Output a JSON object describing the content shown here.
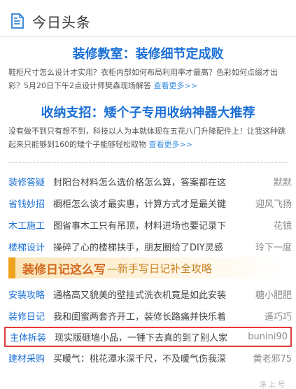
{
  "header": {
    "title": "今日头条",
    "icon": "document-icon"
  },
  "features": [
    {
      "headline": "装修教室：装修细节定成败",
      "summary": "鞋柜尺寸怎么设计才实用？衣柜内部如何布局利用率才最高？色彩如何点缀才出彩？5月20日下午2点设计师樊森现场解答",
      "more": "查看更多>>"
    },
    {
      "headline": "收纳支招：矮个子专用收纳神器大推荐",
      "summary": "没有做不到只有想不到，科技以人为本就体现在五花八门升降配件上！让我这种跳起来只能够到160的矮个子能够轻松取物",
      "more": "查看更多>>"
    }
  ],
  "list_top": [
    {
      "category": "装修答疑",
      "title": "封阳台材料怎么选价格怎么算，答案都在这",
      "user": "默默"
    },
    {
      "category": "省钱妙招",
      "title": "橱柜怎么谈才最实惠，计算方式才是最关键",
      "user": "迎风飞扬"
    },
    {
      "category": "木工施工",
      "title": "图省事木工只有吊顶，材料进场也要记录下",
      "user": "花镜"
    },
    {
      "category": "楼梯设计",
      "title": "操碎了心的楼梯扶手，朋友圈给了DIY灵感",
      "user": "玲下一度"
    }
  ],
  "banner": {
    "title": "装修日记这么写",
    "subtitle": "—新手写日记补全攻略"
  },
  "list_bottom": [
    {
      "category": "安装攻略",
      "title": "通格高又貌美的壁挂式洗衣机竟是如此安装",
      "user": "糖小肥肥",
      "highlight": false
    },
    {
      "category": "装修日记",
      "title": "我和闺蜜两套齐开工，装修长路痛并快乐着",
      "user": "遥巧巧",
      "highlight": false
    },
    {
      "category": "主体拆装",
      "title": "现实版砸墙小品，一锤下去真的到了别人家",
      "user": "bunini90",
      "highlight": true
    },
    {
      "category": "建材采购",
      "title": "买暖气：桃花潭水深千尺，不及暖气伤我深",
      "user": "黄老邪75",
      "highlight": false
    }
  ],
  "footer_fragment": "涂 上 号"
}
